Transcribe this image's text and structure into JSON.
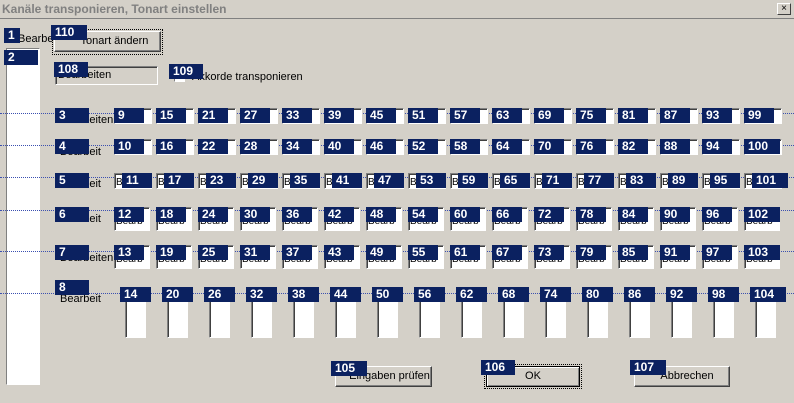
{
  "window": {
    "title": "Kanäle transponieren, Tonart einstellen",
    "close_label": "×"
  },
  "top": {
    "badge1": "1",
    "label1": "Bearbeit",
    "badge2": "2",
    "badge110": "110",
    "change_key_button": "Tonart ändern",
    "badge108": "108",
    "edit108_value": "Bearbeiten",
    "badge109": "109",
    "transpose_chords_label": "Akkorde transponieren"
  },
  "rows": [
    {
      "badge": "3",
      "label": "Bearbeiten",
      "cells": [
        "9",
        "15",
        "21",
        "27",
        "33",
        "39",
        "45",
        "51",
        "57",
        "63",
        "69",
        "75",
        "81",
        "87",
        "93",
        "99"
      ]
    },
    {
      "badge": "4",
      "label": "Bearbeit",
      "cells": [
        "10",
        "16",
        "22",
        "28",
        "34",
        "40",
        "46",
        "52",
        "58",
        "64",
        "70",
        "76",
        "82",
        "88",
        "94",
        "100"
      ]
    },
    {
      "badge": "5",
      "label": "Bearbeit",
      "cells": [
        "11",
        "17",
        "23",
        "29",
        "35",
        "41",
        "47",
        "53",
        "59",
        "65",
        "71",
        "77",
        "83",
        "89",
        "95",
        "101"
      ]
    },
    {
      "badge": "6",
      "label": "Bearbeit",
      "cells": [
        "12",
        "18",
        "24",
        "30",
        "36",
        "42",
        "48",
        "54",
        "60",
        "66",
        "72",
        "78",
        "84",
        "90",
        "96",
        "102"
      ]
    },
    {
      "badge": "7",
      "label": "Bearbeiten",
      "cells": [
        "13",
        "19",
        "25",
        "31",
        "37",
        "43",
        "49",
        "55",
        "61",
        "67",
        "73",
        "79",
        "85",
        "91",
        "97",
        "103"
      ]
    },
    {
      "badge": "8",
      "label": "Bearbeit",
      "cells": [
        "14",
        "20",
        "26",
        "32",
        "38",
        "44",
        "50",
        "56",
        "62",
        "68",
        "74",
        "80",
        "86",
        "92",
        "98",
        "104"
      ]
    }
  ],
  "cell_text": "Bearb",
  "buttons": {
    "check_badge": "105",
    "check_label": "Eingaben prüfen",
    "ok_badge": "106",
    "ok_label": "OK",
    "cancel_badge": "107",
    "cancel_label": "Abbrechen"
  }
}
